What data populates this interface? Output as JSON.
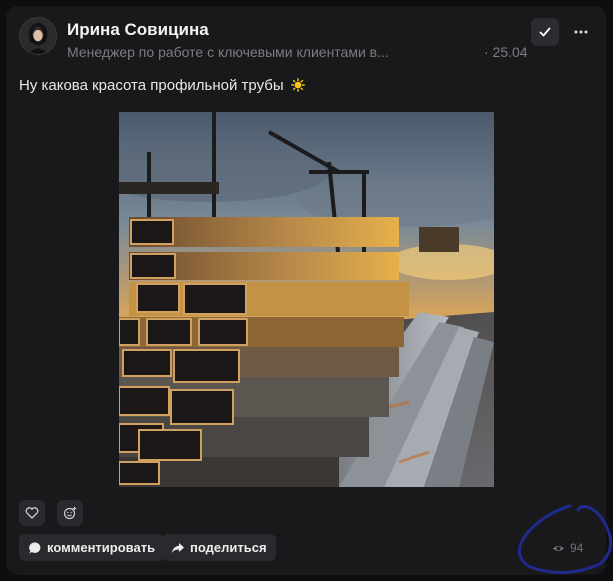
{
  "post": {
    "author": {
      "name": "Ирина Совицина",
      "role": "Менеджер по работе с ключевыми клиентами в...",
      "date": "· 25.04"
    },
    "text": "Ну какова красота профильной трубы",
    "text_emoji": "sun-icon",
    "image": "photo of stacked steel profile pipes at sunset",
    "views": "94"
  },
  "actions": {
    "comment_label": "комментировать",
    "share_label": "поделиться"
  },
  "icons": {
    "check": "check-icon",
    "more": "more-icon",
    "like": "heart-icon",
    "emoji": "emoji-add-icon",
    "comment": "comment-bubble-icon",
    "share": "share-arrow-icon",
    "views": "eye-icon"
  },
  "colors": {
    "background": "#0e0e10",
    "card": "#19191b",
    "button": "#2a2a2e",
    "muted_text": "#7d7d82",
    "annotation": "#1f2a8c"
  }
}
